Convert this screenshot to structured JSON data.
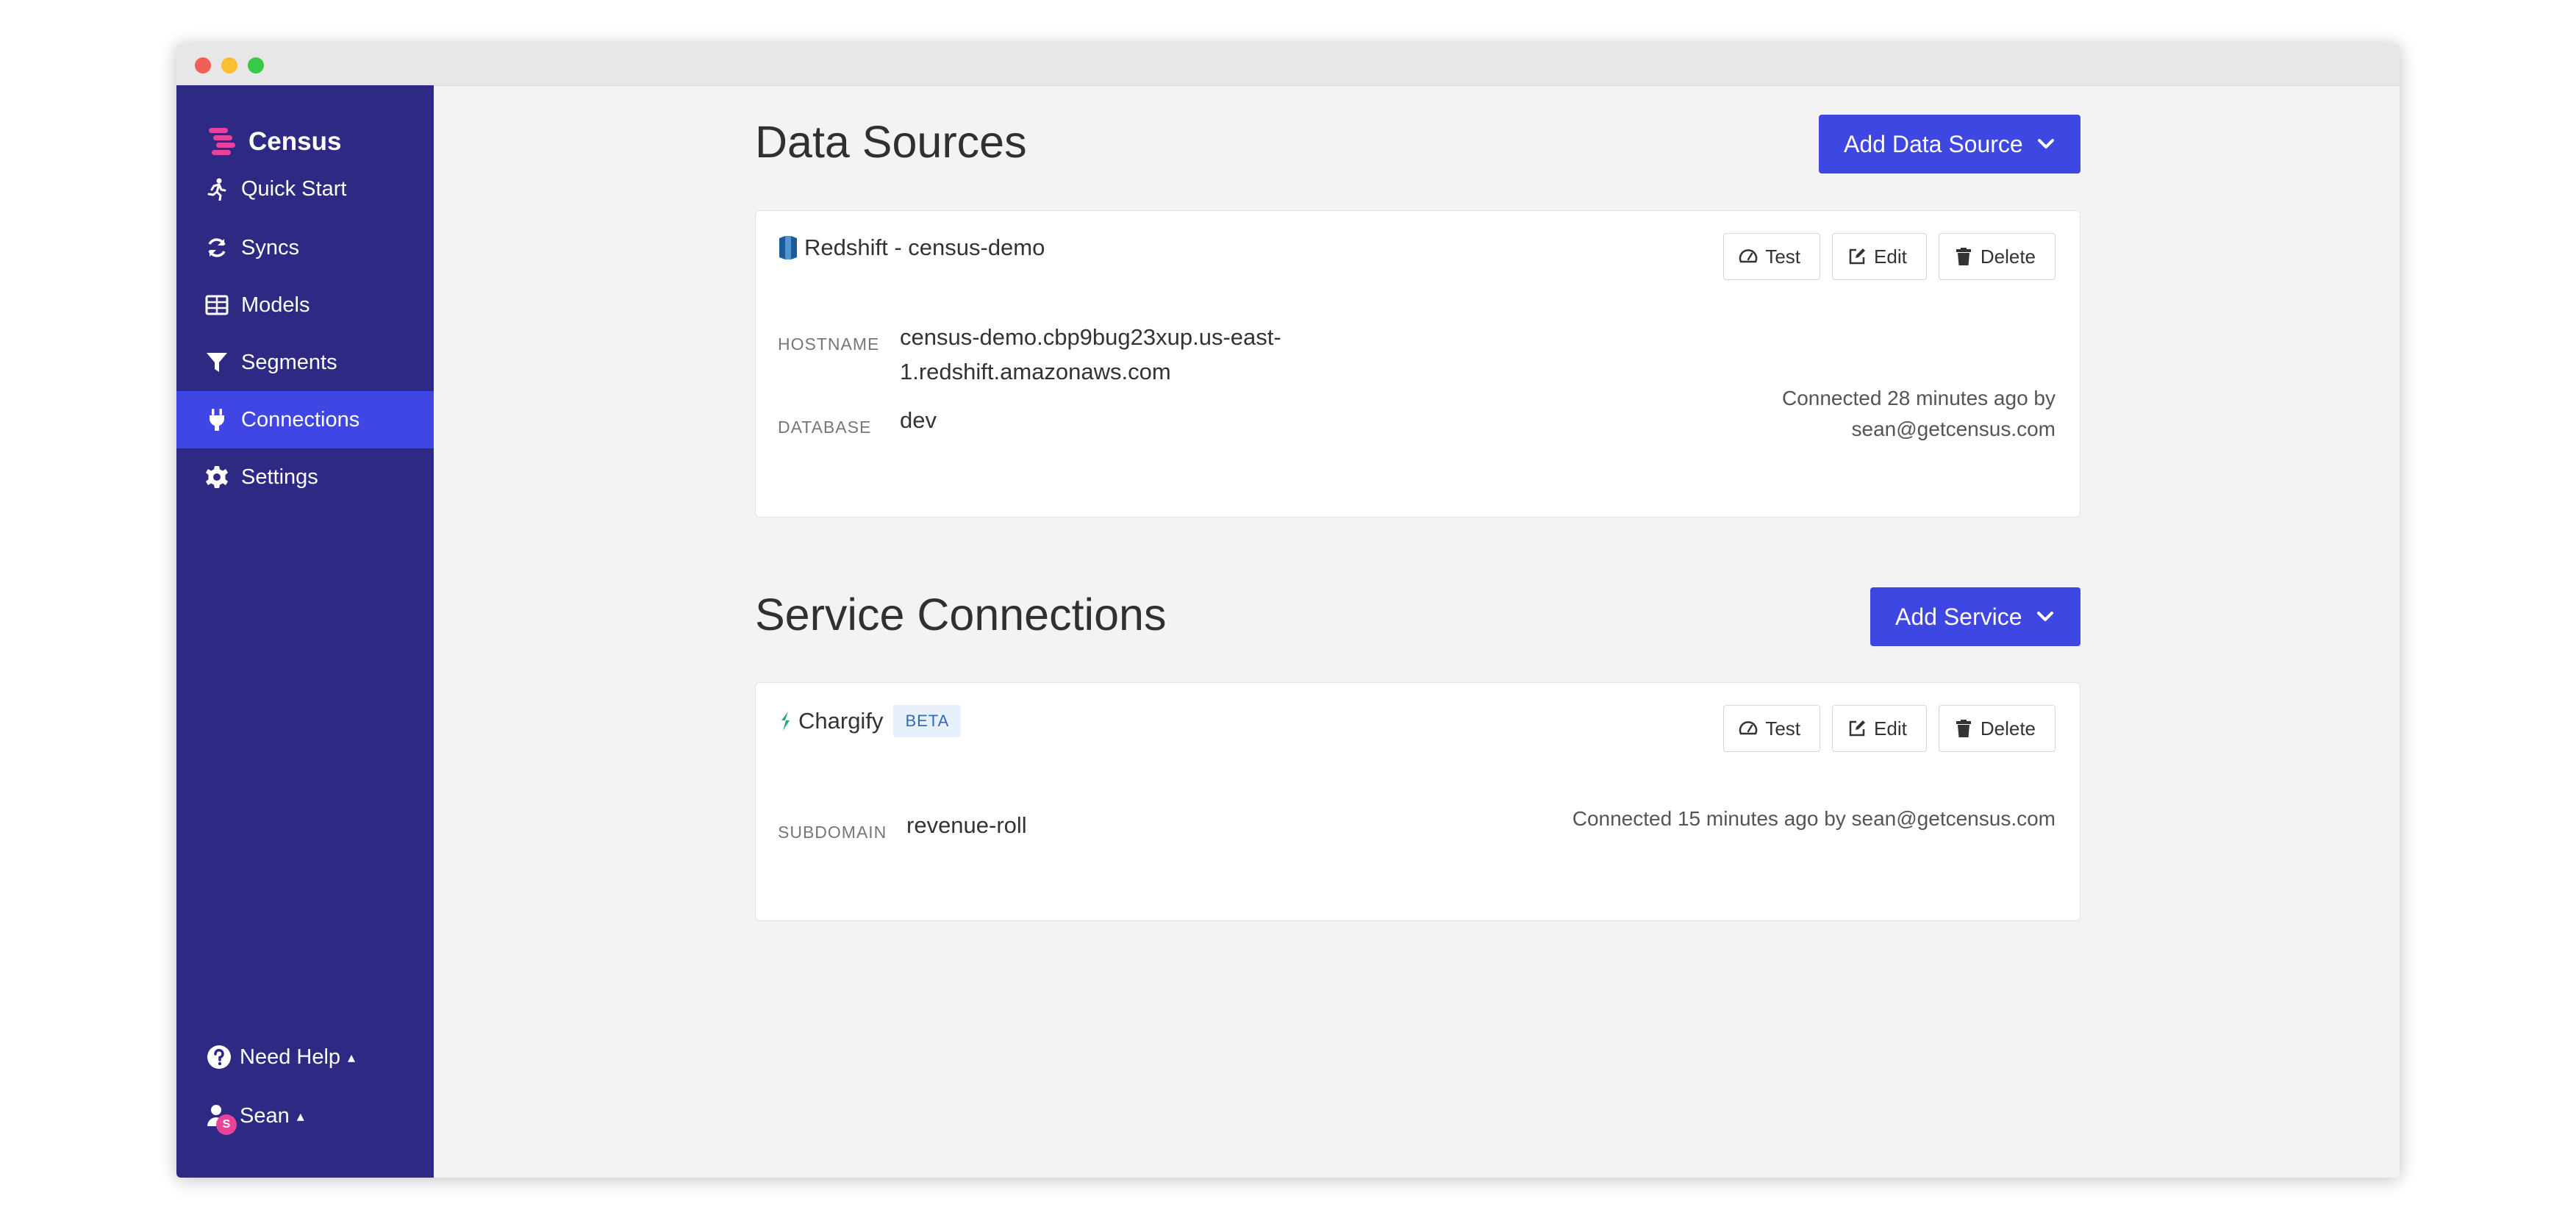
{
  "brand": {
    "name": "Census"
  },
  "sidebar": {
    "items": [
      {
        "label": "Quick Start",
        "icon": "running-icon"
      },
      {
        "label": "Syncs",
        "icon": "sync-icon"
      },
      {
        "label": "Models",
        "icon": "table-icon"
      },
      {
        "label": "Segments",
        "icon": "filter-icon"
      },
      {
        "label": "Connections",
        "icon": "plug-icon",
        "active": true
      },
      {
        "label": "Settings",
        "icon": "gear-icon"
      }
    ],
    "help": {
      "label": "Need Help",
      "caret": "▴"
    },
    "user": {
      "label": "Sean",
      "caret": "▴",
      "badge": "S"
    }
  },
  "data_sources": {
    "title": "Data Sources",
    "add_button": "Add Data Source",
    "card": {
      "name": "Redshift - census-demo",
      "actions": {
        "test": "Test",
        "edit": "Edit",
        "delete": "Delete"
      },
      "hostname_label": "HOSTNAME",
      "hostname_line1": "census-demo.cbp9bug23xup.us-east-",
      "hostname_line2": "1.redshift.amazonaws.com",
      "database_label": "DATABASE",
      "database_value": "dev",
      "connected_line1": "Connected 28 minutes ago by",
      "connected_line2": "sean@getcensus.com"
    }
  },
  "service_connections": {
    "title": "Service Connections",
    "add_button": "Add Service",
    "card": {
      "name": "Chargify",
      "badge": "BETA",
      "actions": {
        "test": "Test",
        "edit": "Edit",
        "delete": "Delete"
      },
      "subdomain_label": "SUBDOMAIN",
      "subdomain_value": "revenue-roll",
      "connected": "Connected 15 minutes ago by sean@getcensus.com"
    }
  },
  "colors": {
    "sidebar_bg": "#2e2a84",
    "active_item": "#4046e3",
    "primary_button": "#3f47e3",
    "brand_accent": "#e9429a"
  }
}
